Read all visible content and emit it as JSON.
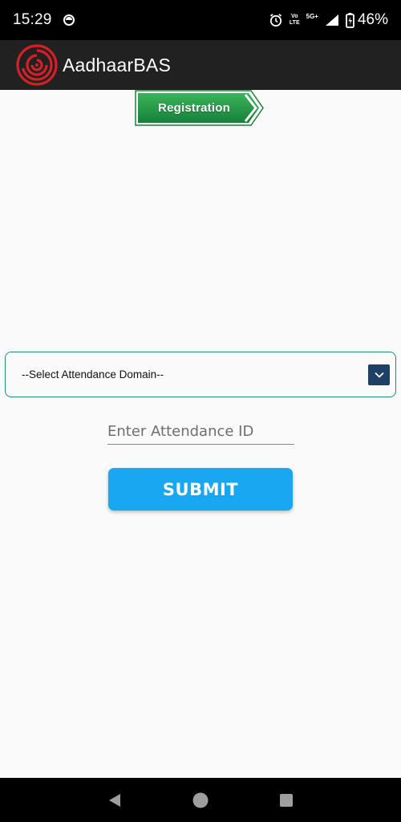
{
  "status_bar": {
    "time": "15:29",
    "volte_top": "Vo",
    "volte_bottom": "LTE",
    "network": "5G+",
    "battery_percent": "46%"
  },
  "app_bar": {
    "title": "AadhaarBAS"
  },
  "registration": {
    "label": "Registration"
  },
  "form": {
    "domain_select_value": "--Select Attendance Domain--",
    "attendance_id_placeholder": "Enter Attendance ID",
    "attendance_id_value": "",
    "submit_label": "SUBMIT"
  },
  "nav_bar": {
    "icons": [
      "back-icon",
      "home-icon",
      "recents-icon"
    ]
  },
  "colors": {
    "app_bar": "#212121",
    "submit": "#1aa7f2",
    "select_border": "#1f8a7a",
    "chevron_box": "#1e3f66",
    "registration_green": "#2a9a46"
  }
}
